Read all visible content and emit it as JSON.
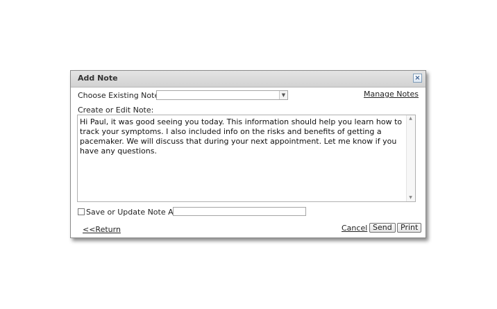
{
  "dialog": {
    "title": "Add Note",
    "close_label": "×",
    "choose_label": "Choose Existing Note:",
    "choose_value": "",
    "manage_notes": "Manage Notes",
    "edit_label": "Create or Edit Note:",
    "note_text": "Hi Paul, it was good seeing you today. This information should help you learn how to track your symptoms. I also included info on the risks and benefits of getting a pacemaker. We will discuss that during your next appointment. Let me know if you have any questions.",
    "save_label": "Save or Update Note As:",
    "save_checked": false,
    "save_value": "",
    "return_link": "<<Return",
    "cancel_link": "Cancel",
    "send_button": "Send",
    "print_button": "Print"
  }
}
